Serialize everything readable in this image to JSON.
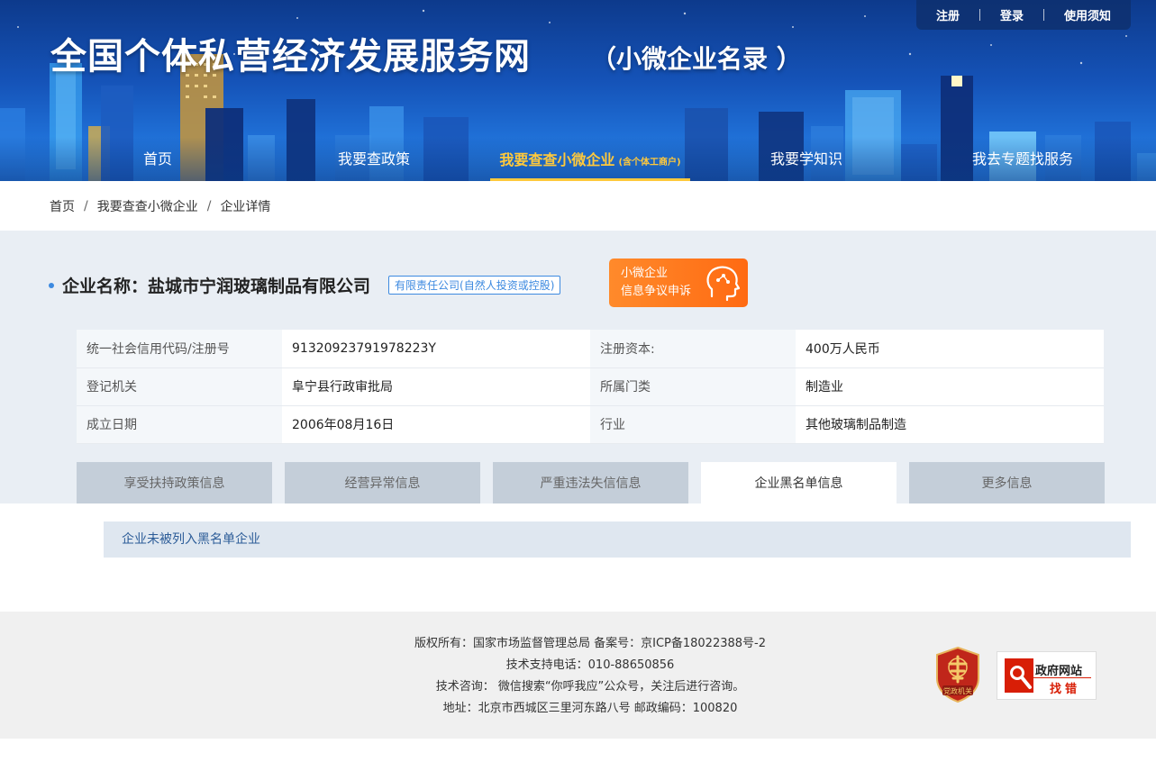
{
  "header": {
    "site_title": "全国个体私营经济发展服务网",
    "site_subtitle": "（小微企业名录 ）",
    "top_links": [
      "注册",
      "登录",
      "使用须知"
    ],
    "nav": [
      {
        "label": "首页",
        "active": false
      },
      {
        "label": "我要查政策",
        "active": false
      },
      {
        "label": "我要查查小微企业",
        "note": "(含个体工商户)",
        "active": true
      },
      {
        "label": "我要学知识",
        "active": false
      },
      {
        "label": "我去专题找服务",
        "active": false
      }
    ]
  },
  "breadcrumb": [
    "首页",
    "我要查查小微企业",
    "企业详情"
  ],
  "company": {
    "name_label": "企业名称：盐城市宁润玻璃制品有限公司",
    "type_tag": "有限责任公司(自然人投资或控股)",
    "appeal_line1": "小微企业",
    "appeal_line2": "信息争议申诉"
  },
  "info_table": [
    {
      "k1": "统一社会信用代码/注册号",
      "v1": "91320923791978223Y",
      "k2": "注册资本:",
      "v2": "400万人民币"
    },
    {
      "k1": "登记机关",
      "v1": "阜宁县行政审批局",
      "k2": "所属门类",
      "v2": "制造业"
    },
    {
      "k1": "成立日期",
      "v1": "2006年08月16日",
      "k2": "行业",
      "v2": "其他玻璃制品制造"
    }
  ],
  "tabs": [
    {
      "label": "享受扶持政策信息",
      "active": false
    },
    {
      "label": "经营异常信息",
      "active": false
    },
    {
      "label": "严重违法失信信息",
      "active": false
    },
    {
      "label": "企业黑名单信息",
      "active": true
    },
    {
      "label": "更多信息",
      "active": false
    }
  ],
  "result_text": "企业未被列入黑名单企业",
  "footer": {
    "lines": [
      "版权所有：国家市场监督管理总局 备案号：京ICP备18022388号-2",
      "技术支持电话：010-88650856",
      "技术咨询： 微信搜索“你呼我应”公众号，关注后进行咨询。",
      "地址：北京市西城区三里河东路八号 邮政编码：100820"
    ],
    "party_badge_text": "党政机关",
    "gov_badge_line1": "政府网站",
    "gov_badge_line2": "找错"
  },
  "colors": {
    "header_blue": "#1553b8",
    "nav_active": "#ffc93c",
    "accent_blue": "#3d8ae0",
    "appeal_orange": "#ff6a12",
    "result_text": "#2c5c98"
  }
}
